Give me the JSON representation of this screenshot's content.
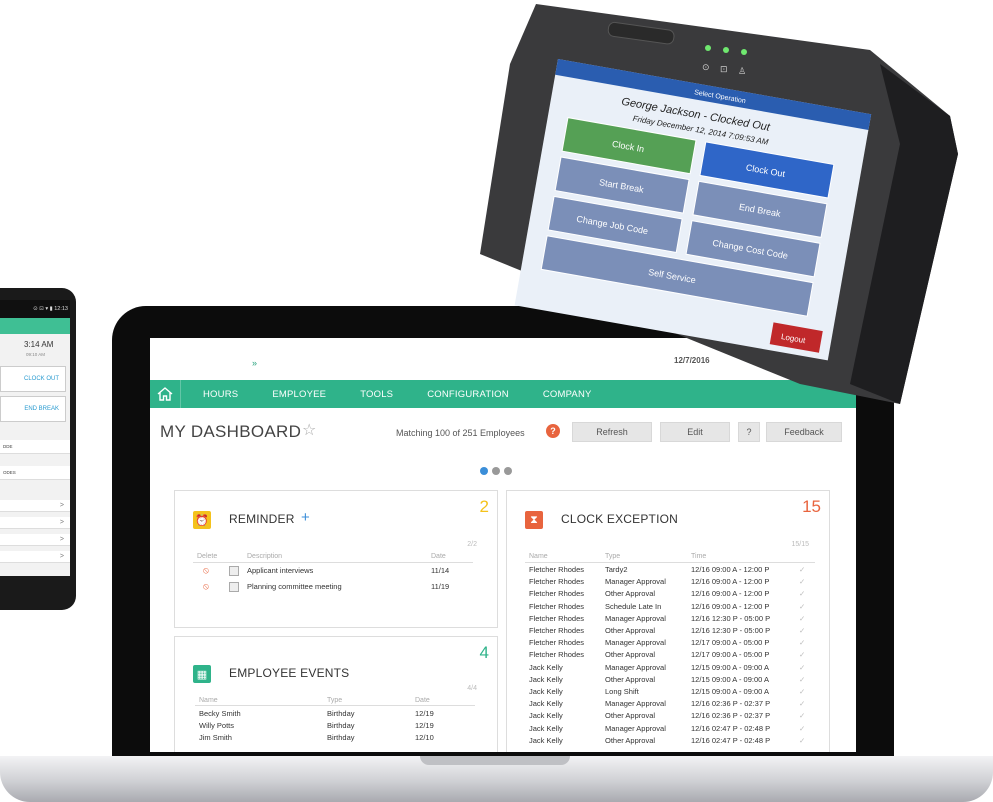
{
  "dashboard": {
    "crumb": "»",
    "date": "12/7/2016",
    "nav": [
      "HOURS",
      "EMPLOYEE",
      "TOOLS",
      "CONFIGURATION",
      "COMPANY"
    ],
    "title": "MY DASHBOARD",
    "matching": "Matching 100 of 251 Employees",
    "help": "?",
    "buttons": {
      "refresh": "Refresh",
      "edit": "Edit",
      "help": "?",
      "feedback": "Feedback"
    },
    "colors": {
      "accent": "#2fb38a",
      "reminder": "#f4c21c",
      "exception": "#e8643e",
      "events": "#2fb38a",
      "dots_active": "#3b8ed8"
    },
    "reminder": {
      "title": "REMINDER",
      "add": "+",
      "count": "2",
      "fraction": "2/2",
      "headers": {
        "delete": "Delete",
        "description": "Description",
        "date": "Date"
      },
      "rows": [
        {
          "description": "Applicant interviews",
          "date": "11/14"
        },
        {
          "description": "Planning committee meeting",
          "date": "11/19"
        }
      ]
    },
    "events": {
      "title": "EMPLOYEE EVENTS",
      "count": "4",
      "fraction": "4/4",
      "headers": {
        "name": "Name",
        "type": "Type",
        "date": "Date"
      },
      "rows": [
        {
          "name": "Becky Smith",
          "type": "Birthday",
          "date": "12/19"
        },
        {
          "name": "Willy Potts",
          "type": "Birthday",
          "date": "12/19"
        },
        {
          "name": "Jim Smith",
          "type": "Birthday",
          "date": "12/10"
        }
      ]
    },
    "exception": {
      "title": "CLOCK EXCEPTION",
      "count": "15",
      "fraction": "15/15",
      "headers": {
        "name": "Name",
        "type": "Type",
        "time": "Time"
      },
      "rows": [
        {
          "name": "Fletcher Rhodes",
          "type": "Tardy2",
          "time": "12/16 09:00 A - 12:00 P"
        },
        {
          "name": "Fletcher Rhodes",
          "type": "Manager Approval",
          "time": "12/16 09:00 A - 12:00 P"
        },
        {
          "name": "Fletcher Rhodes",
          "type": "Other Approval",
          "time": "12/16 09:00 A - 12:00 P"
        },
        {
          "name": "Fletcher Rhodes",
          "type": "Schedule Late In",
          "time": "12/16 09:00 A - 12:00 P"
        },
        {
          "name": "Fletcher Rhodes",
          "type": "Manager Approval",
          "time": "12/16 12:30 P - 05:00 P"
        },
        {
          "name": "Fletcher Rhodes",
          "type": "Other Approval",
          "time": "12/16 12:30 P - 05:00 P"
        },
        {
          "name": "Fletcher Rhodes",
          "type": "Manager Approval",
          "time": "12/17 09:00 A - 05:00 P"
        },
        {
          "name": "Fletcher Rhodes",
          "type": "Other Approval",
          "time": "12/17 09:00 A - 05:00 P"
        },
        {
          "name": "Jack Kelly",
          "type": "Manager Approval",
          "time": "12/15 09:00 A - 09:00 A"
        },
        {
          "name": "Jack Kelly",
          "type": "Other Approval",
          "time": "12/15 09:00 A - 09:00 A"
        },
        {
          "name": "Jack Kelly",
          "type": "Long Shift",
          "time": "12/15 09:00 A - 09:00 A"
        },
        {
          "name": "Jack Kelly",
          "type": "Manager Approval",
          "time": "12/16 02:36 P - 02:37 P"
        },
        {
          "name": "Jack Kelly",
          "type": "Other Approval",
          "time": "12/16 02:36 P - 02:37 P"
        },
        {
          "name": "Jack Kelly",
          "type": "Manager Approval",
          "time": "12/16 02:47 P - 02:48 P"
        },
        {
          "name": "Jack Kelly",
          "type": "Other Approval",
          "time": "12/16 02:47 P - 02:48 P"
        }
      ],
      "check": "✓"
    }
  },
  "phone": {
    "status": "⊙ ⊡ ▾ ▮ 12:13",
    "time": "3:14 AM",
    "date": "09:10 AM",
    "clock_out": "CLOCK OUT",
    "end_break": "END BREAK",
    "items": [
      "DDE",
      "ODES"
    ],
    "chevron": ">"
  },
  "terminal": {
    "header": "Select Operation",
    "employee": "George Jackson - Clocked Out",
    "datetime": "Friday December 12, 2014 7:09:53 AM",
    "buttons": {
      "clock_in": "Clock In",
      "clock_out": "Clock Out",
      "start_break": "Start Break",
      "end_break": "End Break",
      "change_job": "Change Job Code",
      "change_cost": "Change Cost Code",
      "self_service": "Self Service",
      "logout": "Logout"
    },
    "leds": [
      "⊙",
      "⊡",
      "♙"
    ]
  }
}
